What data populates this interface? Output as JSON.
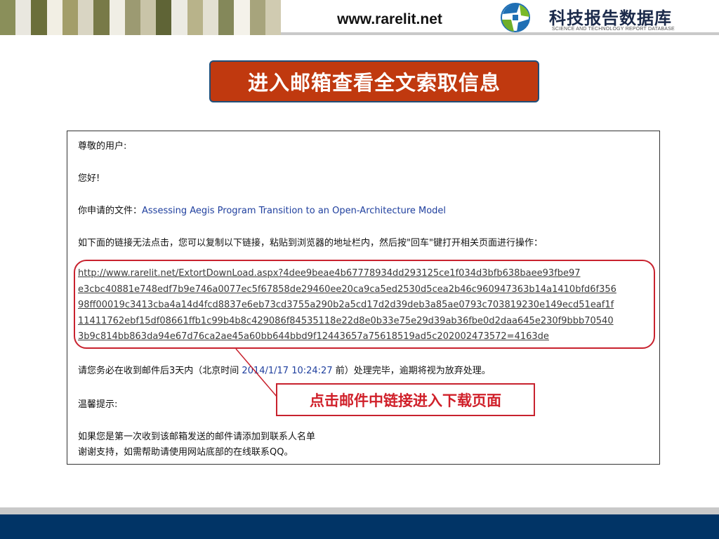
{
  "header": {
    "url": "www.rarelit.net",
    "logo_text": "科技报告数据库",
    "logo_subtitle": "SCIENCE AND TECHNOLOGY REPORT DATABASE",
    "stripe_colors": [
      "#8a8f5a",
      "#e9e7df",
      "#6b6f3a",
      "#f2efe4",
      "#a39e6a",
      "#d9d5c3",
      "#787a48",
      "#f0eee5",
      "#9c9a72",
      "#c9c4a8",
      "#5f6436",
      "#ecebe3",
      "#b8b38a",
      "#e3e0d2",
      "#84885a",
      "#f4f2ea",
      "#a7a47c",
      "#d0cbb1"
    ]
  },
  "title": "进入邮箱查看全文索取信息",
  "email": {
    "salutation": "尊敬的用户:",
    "greeting": "您好!",
    "file_prefix": "你申请的文件：",
    "file_title": "Assessing Aegis Program Transition to an Open-Architecture Model",
    "instruction": "如下面的链接无法点击，您可以复制以下链接，粘贴到浏览器的地址栏内，然后按\"回车\"键打开相关页面进行操作：",
    "link_lines": [
      "http://www.rarelit.net/ExtortDownLoad.aspx?4dee9beae4b67778934dd293125ce1f034d3bfb638baee93fbe97",
      "e3cbc40881e748edf7b9e746a0077ec5f67858de29460ee20ca9ca5ed2530d5cea2b46c960947363b14a1410bfd6f356",
      "98ff00019c3413cba4a14d4fcd8837e6eb73cd3755a290b2a5cd17d2d39deb3a85ae0793c703819230e149ecd51eaf1f",
      "11411762ebf15df08661ffb1c99b4b8c429086f84535118e22d8e0b33e75e29d39ab36fbe0d2daa645e230f9bbb70540",
      "3b9c814bb863da94e67d76ca2ae45a60bb644bbd9f12443657a75618519ad5c202002473572=4163de"
    ],
    "deadline_prefix": "请您务必在收到邮件后3天内（北京时间",
    "deadline_time": "2014/1/17 10:24:27",
    "deadline_suffix": "前）处理完毕，逾期将视为放弃处理。",
    "tip_label": "温馨提示:",
    "tip_line1": "如果您是第一次收到该邮箱发送的邮件请添加到联系人名单",
    "tip_line2": "谢谢支持，如需帮助请使用网站底部的在线联系QQ。"
  },
  "callout": "点击邮件中链接进入下载页面",
  "colors": {
    "title_bg": "#c0390f",
    "accent_red": "#c8222e",
    "footer_blue": "#013466"
  }
}
